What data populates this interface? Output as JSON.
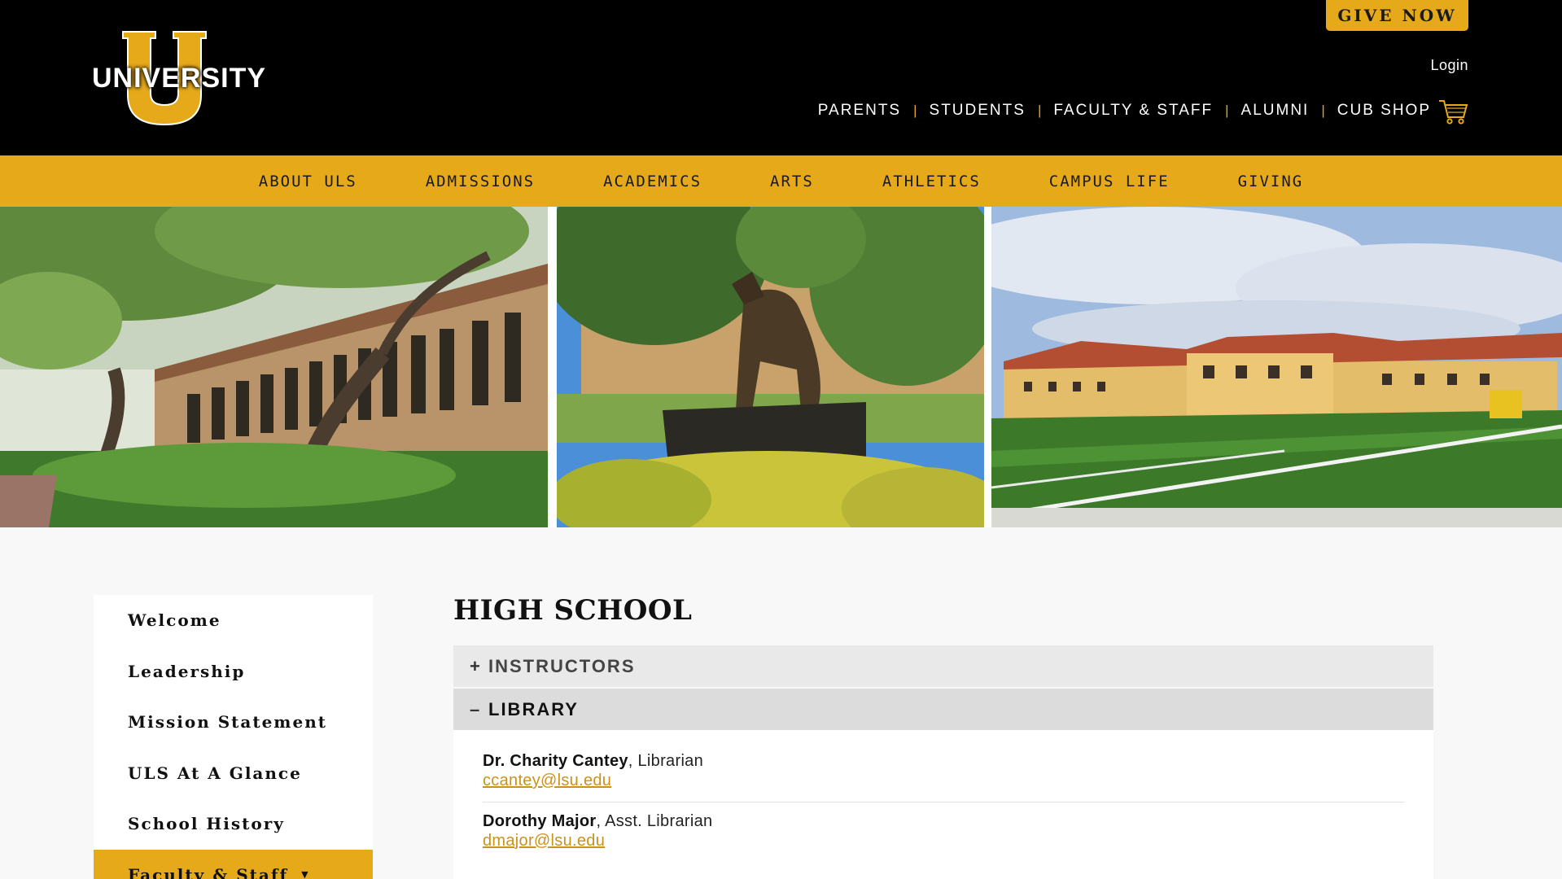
{
  "header": {
    "logo_text": "UNIVERSITY",
    "give_now": "GIVE NOW",
    "login": "Login",
    "audience_nav": [
      {
        "label": "PARENTS"
      },
      {
        "label": "STUDENTS"
      },
      {
        "label": "FACULTY & STAFF"
      },
      {
        "label": "ALUMNI"
      },
      {
        "label": "CUB SHOP"
      }
    ],
    "cart_icon": "shopping-cart-icon"
  },
  "main_nav": [
    {
      "label": "ABOUT ULS"
    },
    {
      "label": "ADMISSIONS"
    },
    {
      "label": "ACADEMICS"
    },
    {
      "label": "ARTS"
    },
    {
      "label": "ATHLETICS"
    },
    {
      "label": "CAMPUS LIFE"
    },
    {
      "label": "GIVING"
    }
  ],
  "sidebar": {
    "items": [
      {
        "label": "Welcome"
      },
      {
        "label": "Leadership"
      },
      {
        "label": "Mission Statement"
      },
      {
        "label": "ULS At A Glance"
      },
      {
        "label": "School History"
      },
      {
        "label": "Faculty & Staff",
        "active": true
      }
    ],
    "caret": "▼"
  },
  "content": {
    "title": "HIGH SCHOOL",
    "accordions": [
      {
        "label": "INSTRUCTORS",
        "sign": "+",
        "expanded": false
      },
      {
        "label": "LIBRARY",
        "sign": "–",
        "expanded": true
      }
    ],
    "contacts": [
      {
        "name": "Dr. Charity Cantey",
        "role": ", Librarian",
        "email": "ccantey@lsu.edu"
      },
      {
        "name": "Dorothy Major",
        "role": ", Asst. Librarian",
        "email": "dmajor@lsu.edu"
      }
    ]
  },
  "colors": {
    "brand_gold": "#e6a91a",
    "header_bg": "#000000",
    "link": "#c9921a"
  }
}
